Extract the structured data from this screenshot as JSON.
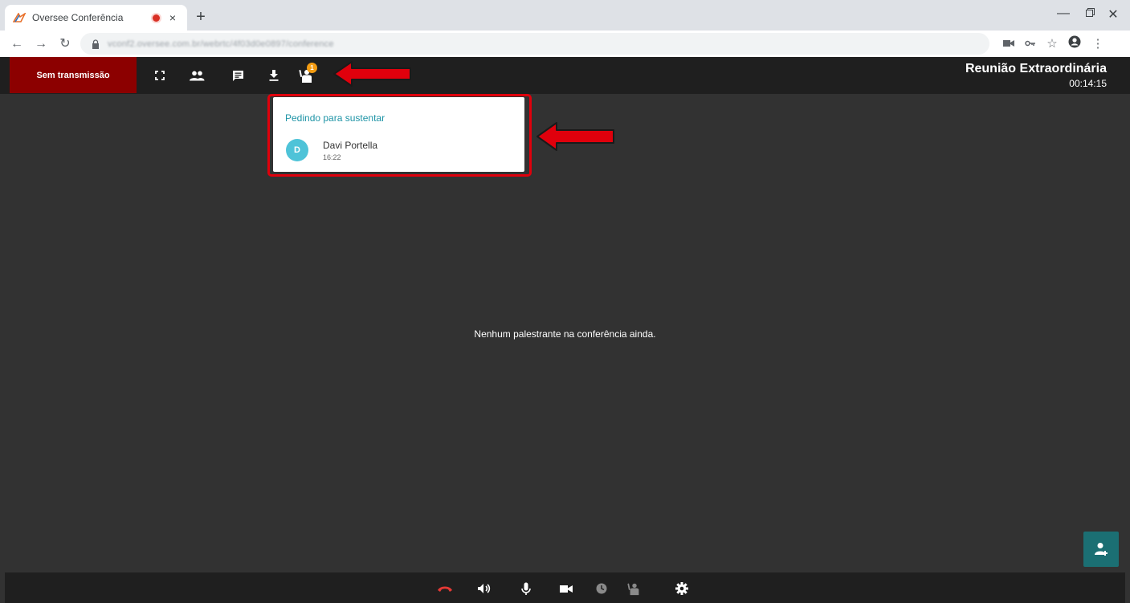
{
  "browser": {
    "tab_title": "Oversee Conferência",
    "tab_close": "×",
    "new_tab": "+",
    "url": "vconf2.oversee.com.br/webrtc/4f03d0e0897/conference"
  },
  "header": {
    "transmission_label": "Sem transmissão",
    "hand_raise_badge": "1",
    "meeting_title": "Reunião Extraordinária",
    "elapsed_time": "00:14:15"
  },
  "popup": {
    "title": "Pedindo para sustentar",
    "requests": [
      {
        "initial": "D",
        "name": "Davi Portella",
        "time": "16:22"
      }
    ]
  },
  "stage": {
    "empty_message": "Nenhum palestrante na conferência ainda."
  },
  "colors": {
    "transmission_button": "#8c0000",
    "popup_title": "#1e94a6",
    "avatar": "#4ec3d8",
    "badge": "#f39c12",
    "annotation": "#e0000c",
    "invite_button": "#1b6f73",
    "hangup": "#e53935"
  },
  "icons": {
    "header": [
      "fullscreen-icon",
      "participants-icon",
      "chat-icon",
      "download-icon",
      "raised-hand-icon"
    ],
    "bottom": [
      "hangup-icon",
      "speaker-icon",
      "microphone-icon",
      "camera-icon",
      "clock-icon",
      "raise-hand-icon",
      "settings-icon"
    ]
  }
}
